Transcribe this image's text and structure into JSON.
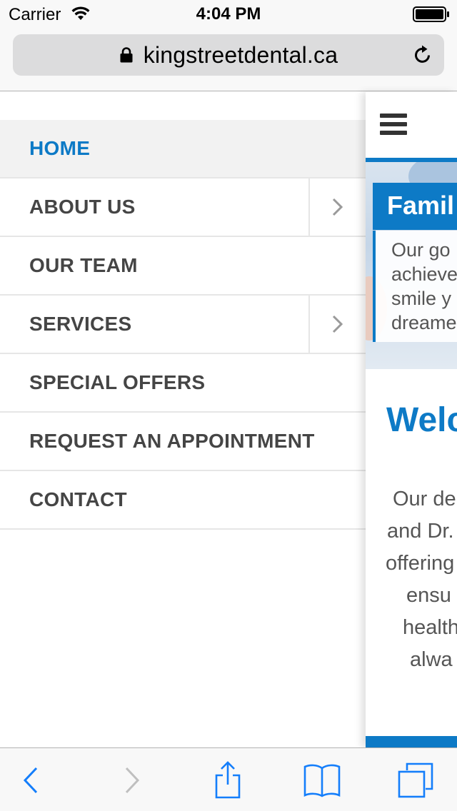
{
  "status_bar": {
    "carrier": "Carrier",
    "time": "4:04 PM"
  },
  "browser": {
    "url": "kingstreetdental.ca",
    "accent_color": "#147efb"
  },
  "menu": {
    "items": [
      {
        "label": "HOME",
        "active": true,
        "has_submenu": false
      },
      {
        "label": "ABOUT US",
        "active": false,
        "has_submenu": true
      },
      {
        "label": "OUR TEAM",
        "active": false,
        "has_submenu": false
      },
      {
        "label": "SERVICES",
        "active": false,
        "has_submenu": true
      },
      {
        "label": "SPECIAL OFFERS",
        "active": false,
        "has_submenu": false
      },
      {
        "label": "REQUEST AN APPOINTMENT",
        "active": false,
        "has_submenu": false
      },
      {
        "label": "CONTACT",
        "active": false,
        "has_submenu": false
      }
    ],
    "active_color": "#0d7ac6"
  },
  "page": {
    "hero_title": "Famil",
    "hero_text": [
      "Our go",
      "achieve",
      "smile y",
      "dreame"
    ],
    "welcome_heading": "Welc",
    "body_lines": [
      "Our de",
      "and Dr.",
      "offering",
      "ensu",
      "health",
      "alwa"
    ],
    "brand_color": "#0d7ac6"
  },
  "toolbar": {
    "icons": [
      "back-icon",
      "forward-icon",
      "share-icon",
      "bookmarks-icon",
      "tabs-icon"
    ]
  }
}
